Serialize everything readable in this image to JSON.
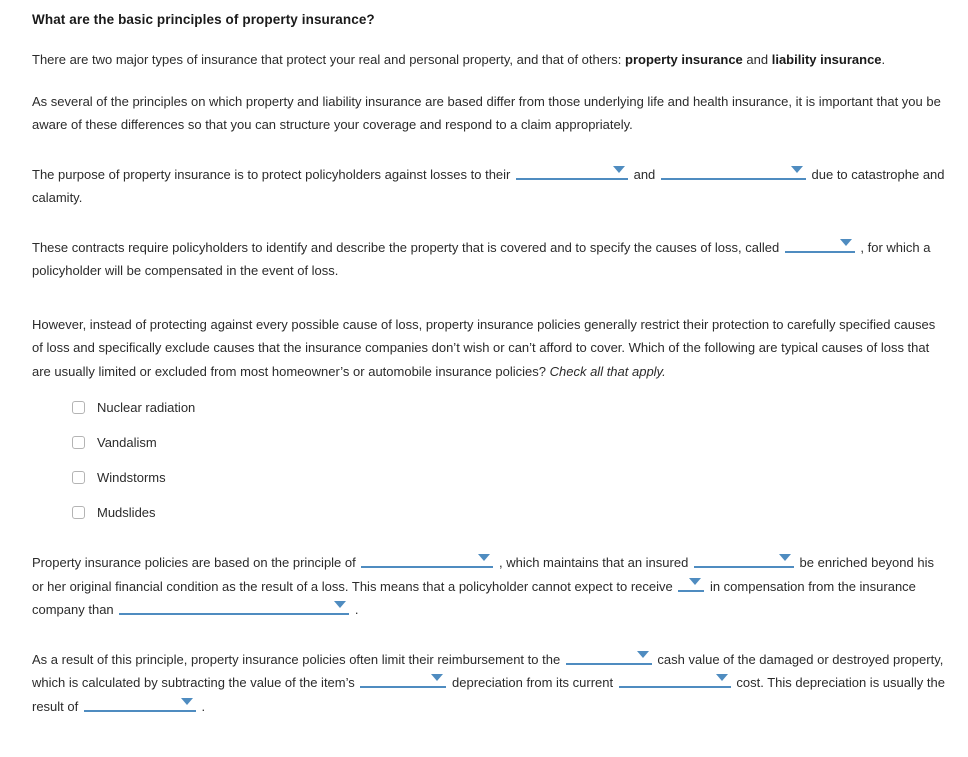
{
  "heading": "What are the basic principles of property insurance?",
  "paragraphs": {
    "intro_a": "There are two major types of insurance that protect your real and personal property, and that of others: ",
    "intro_bold1": "property insurance",
    "intro_b": " and ",
    "intro_bold2": "liability insurance",
    "intro_c": ".",
    "differences": "As several of the principles on which property and liability insurance are based differ from those underlying life and health insurance, it is important that you be aware of these differences so that you can structure your coverage and respond to a claim appropriately.",
    "purpose_a": "The purpose of property insurance is to protect policyholders against losses to their ",
    "purpose_b": " and ",
    "purpose_c": " due to catastrophe and calamity.",
    "contracts_a": "These contracts require policyholders to identify and describe the property that is covered and to specify the causes of loss, called ",
    "contracts_b": " , for which a policyholder will be compensated in the event of loss.",
    "however_a": "However, instead of protecting against every possible cause of loss, property insurance policies generally restrict their protection to carefully specified causes of loss and specifically exclude causes that the insurance companies don’t wish or can’t afford to cover. Which of the following are typical causes of loss that are usually limited or excluded from most homeowner’s or automobile insurance policies? ",
    "however_italic": "Check all that apply.",
    "principle_a": "Property insurance policies are based on the principle of ",
    "principle_b": " , which maintains that an insured ",
    "principle_c": " be enriched beyond his or her original financial condition as the result of a loss. This means that a policyholder cannot expect to receive ",
    "principle_d": " in compensation from the insurance company than ",
    "principle_e": " .",
    "result_a": "As a result of this principle, property insurance policies often limit their reimbursement to the ",
    "result_b": " cash value of the damaged or destroyed property, which is calculated by subtracting the value of the item’s ",
    "result_c": " depreciation from its current ",
    "result_d": " cost. This depreciation is usually the result of ",
    "result_e": " ."
  },
  "checkboxes": [
    {
      "label": "Nuclear radiation",
      "checked": false
    },
    {
      "label": "Vandalism",
      "checked": false
    },
    {
      "label": "Windstorms",
      "checked": false
    },
    {
      "label": "Mudslides",
      "checked": false
    }
  ],
  "dropdowns": {
    "purpose_1": "",
    "purpose_2": "",
    "contracts_1": "",
    "principle_1": "",
    "principle_2": "",
    "principle_3": "",
    "principle_4": "",
    "result_1": "",
    "result_2": "",
    "result_3": "",
    "result_4": ""
  },
  "colors": {
    "accent_blue": "#4f8cc0",
    "text": "#2b2b2b",
    "heading": "#1a1a1a",
    "checkbox_border": "#b4b4b4",
    "background": "#ffffff"
  }
}
